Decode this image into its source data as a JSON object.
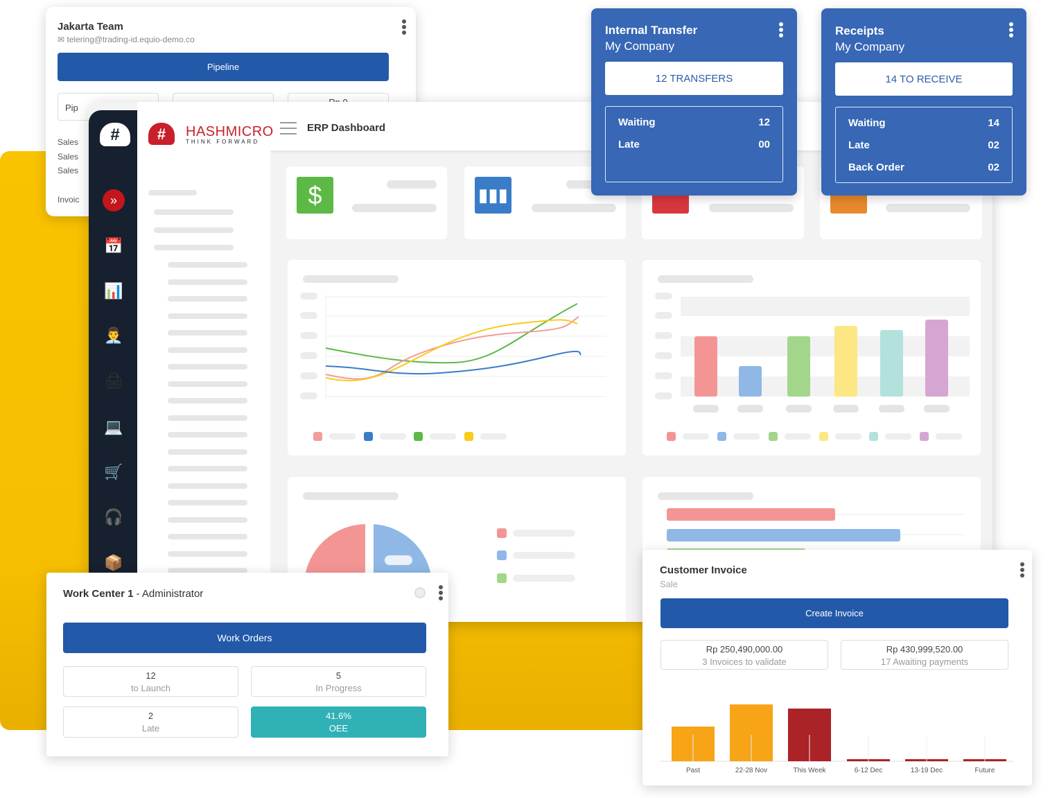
{
  "team_card": {
    "title": "Jakarta Team",
    "email": "telering@trading-id.equio-demo.co",
    "button": "Pipeline",
    "boxes": [
      "Pip",
      "",
      "Rp 0"
    ],
    "links": [
      "Sales",
      "Sales",
      "Sales",
      "Invoic"
    ]
  },
  "dashboard": {
    "brand": "HASHMICRO",
    "tagline": "THINK FORWARD",
    "title": "ERP Dashboard"
  },
  "internal_transfer": {
    "title": "Internal Transfer",
    "company": "My Company",
    "button": "12 TRANSFERS",
    "rows": [
      {
        "label": "Waiting",
        "value": "12"
      },
      {
        "label": "Late",
        "value": "00"
      }
    ]
  },
  "receipts": {
    "title": "Receipts",
    "company": "My Company",
    "button": "14 TO RECEIVE",
    "rows": [
      {
        "label": "Waiting",
        "value": "14"
      },
      {
        "label": "Late",
        "value": "02"
      },
      {
        "label": "Back Order",
        "value": "02"
      }
    ]
  },
  "work_center": {
    "title": "Work Center 1",
    "role": "- Administrator",
    "button": "Work Orders",
    "stats": [
      {
        "value": "12",
        "label": "to Launch"
      },
      {
        "value": "5",
        "label": "In Progress"
      },
      {
        "value": "2",
        "label": "Late"
      },
      {
        "value": "41.6%",
        "label": "OEE"
      }
    ],
    "oee_color": "#2fb1b6"
  },
  "customer_invoice": {
    "title": "Customer Invoice",
    "subtitle": "Sale",
    "button": "Create Invoice",
    "stats": [
      {
        "value": "Rp 250,490,000.00",
        "label": "3 Invoices to validate"
      },
      {
        "value": "Rp 430,999,520.00",
        "label": "17 Awaiting payments"
      }
    ]
  },
  "chart_data": {
    "type": "bar",
    "categories": [
      "Past",
      "22-28 Nov",
      "This Week",
      "6-12 Dec",
      "13-19 Dec",
      "Future"
    ],
    "values": [
      50,
      82,
      76,
      3,
      3,
      3
    ],
    "colors": [
      "#f7a417",
      "#f7a417",
      "#ab2227",
      "#ab2227",
      "#ab2227",
      "#ab2227"
    ],
    "grid": false
  },
  "colors": {
    "primary": "#2259a9",
    "card_blue": "#3767b5",
    "sidebar": "#16202e",
    "accent_yellow": "#f9c300"
  }
}
